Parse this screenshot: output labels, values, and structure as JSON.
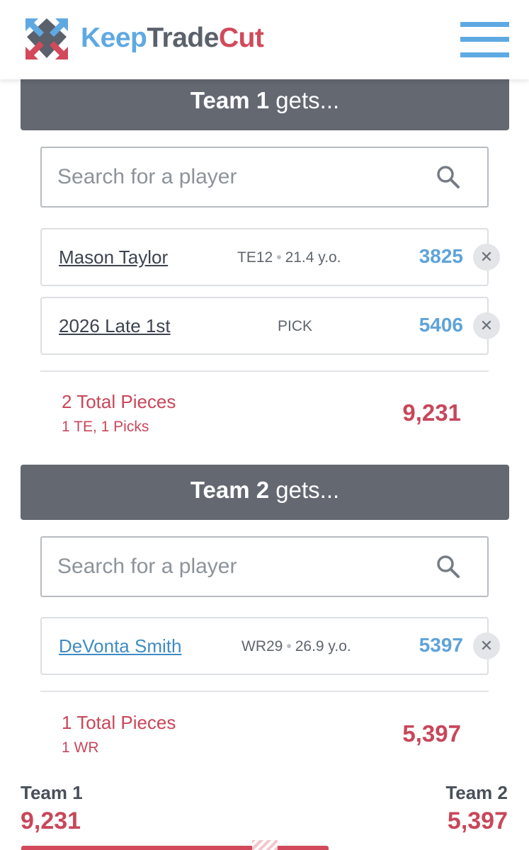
{
  "header": {
    "brand_keep": "Keep",
    "brand_trade": "Trade",
    "brand_cut": "Cut",
    "logo_icon": "keeptradecut-arrows-logo",
    "menu_icon": "hamburger-menu-icon",
    "colors": {
      "blue": "#5fa9e3",
      "gray": "#5a616b",
      "red": "#d1495b"
    }
  },
  "team1": {
    "name": "Team 1",
    "gets": "gets...",
    "search_placeholder": "Search for a player",
    "assets": [
      {
        "name": "Mason Taylor",
        "position": "TE12",
        "age": "21.4 y.o.",
        "value": "3825",
        "remove": "✕"
      },
      {
        "name": "2026 Late 1st",
        "type": "PICK",
        "value": "5406",
        "remove": "✕"
      }
    ],
    "total_pieces": "2 Total Pieces",
    "breakdown": "1 TE, 1 Picks",
    "total_value": "9,231"
  },
  "team2": {
    "name": "Team 2",
    "gets": "gets...",
    "search_placeholder": "Search for a player",
    "assets": [
      {
        "name": "DeVonta Smith",
        "position": "WR29",
        "age": "26.9 y.o.",
        "value": "5397",
        "remove": "✕"
      }
    ],
    "total_pieces": "1 Total Pieces",
    "breakdown": "1 WR",
    "total_value": "5,397"
  },
  "summary": {
    "team1_label": "Team 1",
    "team1_value": "9,231",
    "team2_label": "Team 2",
    "team2_value": "5,397"
  },
  "separator_dot": "•",
  "colors": {
    "accent_blue": "#5fa3d9",
    "total_red": "#c8475a",
    "bar_gray": "#636871"
  }
}
